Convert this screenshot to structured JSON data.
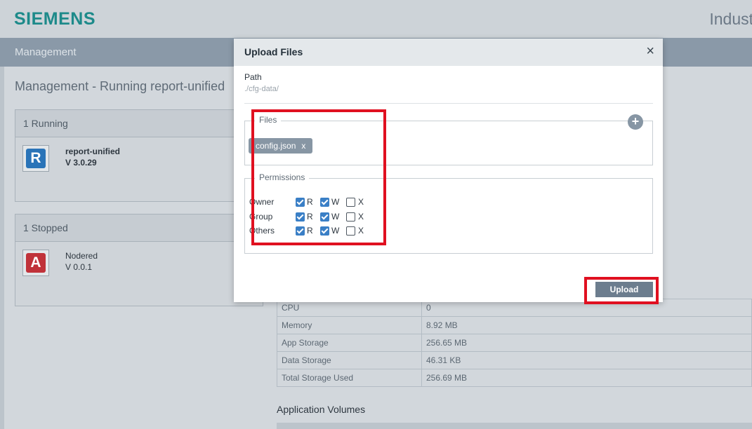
{
  "header": {
    "logo": "SIEMENS",
    "brand_right": "Indust"
  },
  "navbar": {
    "title": "Management"
  },
  "page": {
    "title": "Management - Running report-unified"
  },
  "running": {
    "header": "1 Running",
    "app": {
      "icon_letter": "R",
      "icon_color": "#2a74b8",
      "name": "report-unified",
      "version": "V 3.0.29"
    }
  },
  "stopped": {
    "header": "1 Stopped",
    "app": {
      "icon_letter": "A",
      "icon_color": "#c0323a",
      "name": "Nodered",
      "version": "V 0.0.1"
    }
  },
  "resources": [
    {
      "key": "CPU",
      "value": "0"
    },
    {
      "key": "Memory",
      "value": "8.92 MB"
    },
    {
      "key": "App Storage",
      "value": "256.65 MB"
    },
    {
      "key": "Data Storage",
      "value": "46.31 KB"
    },
    {
      "key": "Total Storage Used",
      "value": "256.69 MB"
    }
  ],
  "volumes": {
    "title": "Application Volumes"
  },
  "modal": {
    "title": "Upload Files",
    "close": "×",
    "path_label": "Path",
    "path_value": "./cfg-data/",
    "files_legend": "Files",
    "add_icon": "+",
    "file_chip": "config.json",
    "chip_remove": "x",
    "permissions_legend": "Permissions",
    "permissions": [
      {
        "label": "Owner",
        "r": true,
        "w": true,
        "x": false
      },
      {
        "label": "Group",
        "r": true,
        "w": true,
        "x": false
      },
      {
        "label": "Others",
        "r": true,
        "w": true,
        "x": false
      }
    ],
    "perm_r": "R",
    "perm_w": "W",
    "perm_x": "X",
    "upload": "Upload"
  },
  "highlight_color": "#e01020"
}
